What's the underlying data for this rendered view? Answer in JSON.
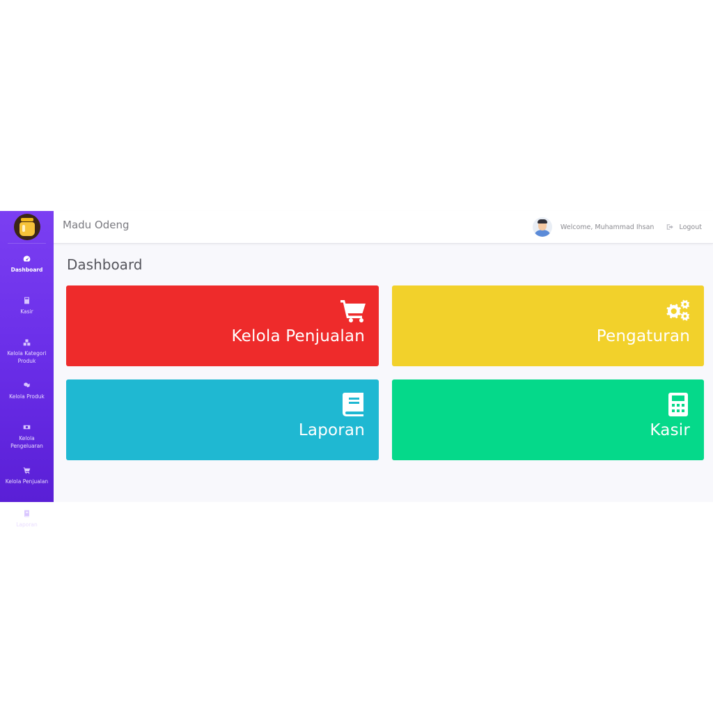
{
  "app": {
    "brand": "Madu Odeng"
  },
  "sidebar": {
    "items": [
      {
        "label": "Dashboard",
        "icon": "tachometer-icon",
        "active": true
      },
      {
        "label": "Kasir",
        "icon": "calculator-icon"
      },
      {
        "label": "Kelola Kategori Produk",
        "icon": "boxes-icon"
      },
      {
        "label": "Kelola Produk",
        "icon": "cubes-icon"
      },
      {
        "label": "Kelola Pengeluaran",
        "icon": "money-icon"
      },
      {
        "label": "Kelola Penjualan",
        "icon": "cart-icon"
      },
      {
        "label": "Laporan",
        "icon": "book-icon"
      }
    ]
  },
  "topbar": {
    "welcome": "Welcome, Muhammad Ihsan",
    "logout": "Logout"
  },
  "page": {
    "title": "Dashboard"
  },
  "cards": [
    {
      "label": "Kelola Penjualan",
      "icon": "cart-icon",
      "color": "#ee2b2b"
    },
    {
      "label": "Pengaturan",
      "icon": "gears-icon",
      "color": "#f2d12b"
    },
    {
      "label": "Laporan",
      "icon": "book-icon",
      "color": "#1fb8d2"
    },
    {
      "label": "Kasir",
      "icon": "calculator-icon",
      "color": "#05d98a"
    }
  ]
}
